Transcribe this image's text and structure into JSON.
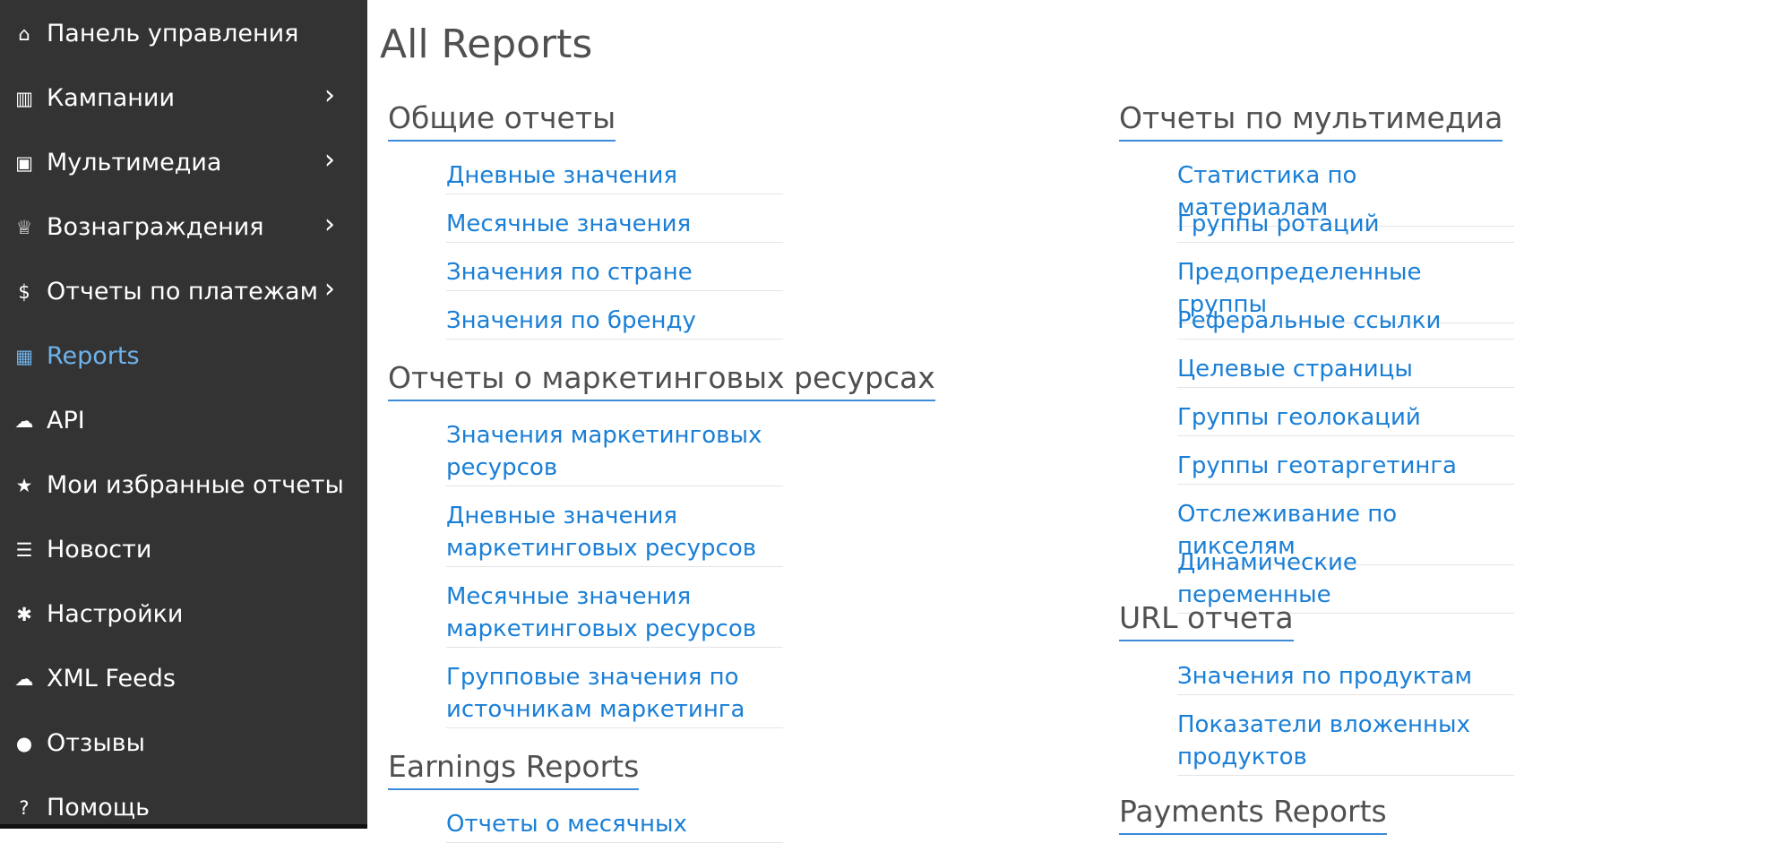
{
  "sidebar": {
    "items": [
      {
        "label": "Панель управления",
        "icon": "home-icon",
        "glyph": "⌂",
        "has_submenu": false
      },
      {
        "label": "Кампании",
        "icon": "bar-chart-icon",
        "glyph": "▥",
        "has_submenu": true
      },
      {
        "label": "Мультимедиа",
        "icon": "image-icon",
        "glyph": "▣",
        "has_submenu": true
      },
      {
        "label": "Вознаграждения",
        "icon": "trophy-icon",
        "glyph": "♕",
        "has_submenu": true
      },
      {
        "label": "Отчеты по платежам",
        "icon": "dollar-icon",
        "glyph": "$",
        "has_submenu": true
      },
      {
        "label": "Reports",
        "icon": "table-icon",
        "glyph": "▦",
        "has_submenu": false,
        "active": true
      },
      {
        "label": "API",
        "icon": "cloud-download-icon",
        "glyph": "☁",
        "has_submenu": false
      },
      {
        "label": "Мои избранные отчеты",
        "icon": "star-icon",
        "glyph": "★",
        "has_submenu": false
      },
      {
        "label": "Новости",
        "icon": "list-icon",
        "glyph": "☰",
        "has_submenu": false
      },
      {
        "label": "Настройки",
        "icon": "gear-icon",
        "glyph": "✱",
        "has_submenu": false
      },
      {
        "label": "XML Feeds",
        "icon": "cloud-download-icon",
        "glyph": "☁",
        "has_submenu": false
      },
      {
        "label": "Отзывы",
        "icon": "comment-icon",
        "glyph": "●",
        "has_submenu": false
      },
      {
        "label": "Помощь",
        "icon": "question-circle-icon",
        "glyph": "?",
        "has_submenu": false
      }
    ],
    "chevron": "›"
  },
  "main": {
    "title": "All Reports",
    "left_column": {
      "sections": [
        {
          "heading": "Общие отчеты",
          "links": [
            "Дневные значения",
            "Месячные значения",
            "Значения по стране",
            "Значения по бренду"
          ]
        },
        {
          "heading": "Отчеты о маркетинговых ресурсах",
          "links": [
            "Значения маркетинговых ресурсов",
            "Дневные значения маркетинговых ресурсов",
            "Месячные значения маркетинговых ресурсов",
            "Групповые значения по источникам маркетинга"
          ]
        },
        {
          "heading": "Earnings Reports",
          "links": [
            "Отчеты о месячных"
          ]
        }
      ]
    },
    "right_column": {
      "sections": [
        {
          "heading": "Отчеты по мультимедиа",
          "links": [
            "Статистика по материалам",
            "Группы ротаций",
            "Предопределенные группы",
            "Реферальные ссылки",
            "Целевые страницы",
            "Группы геолокаций",
            "Группы геотаргетинга",
            "Отслеживание по пикселям",
            "Динамические переменные"
          ]
        },
        {
          "heading": "URL отчета",
          "links": [
            "Значения по продуктам",
            "Показатели вложенных продуктов"
          ]
        },
        {
          "heading": "Payments Reports",
          "links": []
        }
      ]
    }
  },
  "colors": {
    "sidebar_bg": "#333333",
    "active": "#6fb2ea",
    "link": "#1a7fd6",
    "heading_rule": "#3c8ad8"
  }
}
